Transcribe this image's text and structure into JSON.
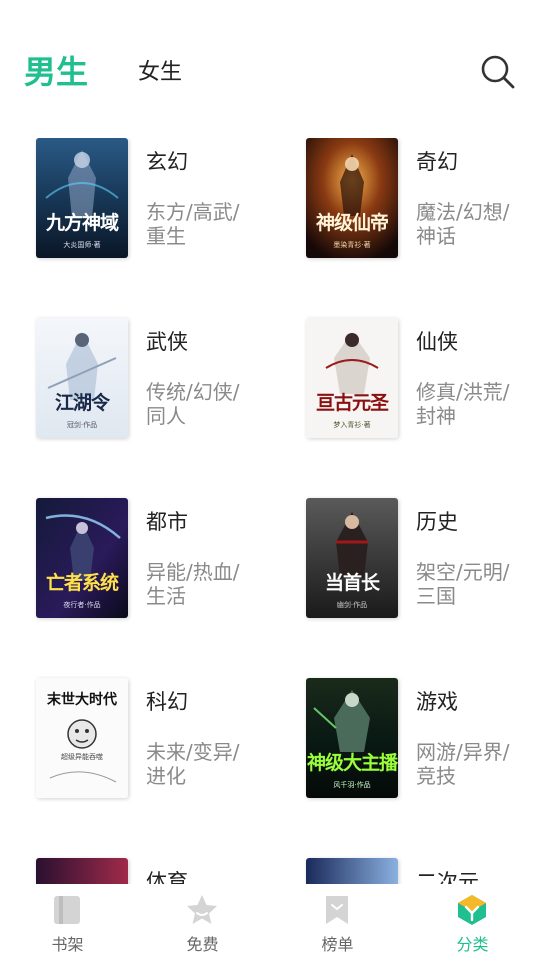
{
  "header": {
    "tab_male": "男生",
    "tab_female": "女生",
    "search_icon": "search-icon"
  },
  "categories": [
    {
      "name": "玄幻",
      "tags": "东方/高武/重生",
      "cover_title": "九方神域",
      "cover_sub": "大炎国师·著"
    },
    {
      "name": "奇幻",
      "tags": "魔法/幻想/神话",
      "cover_title": "神级仙帝",
      "cover_sub": "墨染青衫·著"
    },
    {
      "name": "武侠",
      "tags": "传统/幻侠/同人",
      "cover_title": "江湖令",
      "cover_sub": "冠剑·作品"
    },
    {
      "name": "仙侠",
      "tags": "修真/洪荒/封神",
      "cover_title": "亘古元圣",
      "cover_sub": "梦入青衫·著"
    },
    {
      "name": "都市",
      "tags": "异能/热血/生活",
      "cover_title": "亡者系统",
      "cover_sub": "夜行者·作品"
    },
    {
      "name": "历史",
      "tags": "架空/元明/三国",
      "cover_title": "当首长",
      "cover_sub": "幽剑·作品"
    },
    {
      "name": "科幻",
      "tags": "未来/变异/进化",
      "cover_title": "末世大时代",
      "cover_sub": "超级异能吞噬"
    },
    {
      "name": "游戏",
      "tags": "网游/异界/竞技",
      "cover_title": "神级大主播",
      "cover_sub": "风千羽·作品"
    },
    {
      "name": "体育",
      "tags": "",
      "cover_title": "",
      "cover_sub": ""
    },
    {
      "name": "二次元",
      "tags": "",
      "cover_title": "",
      "cover_sub": ""
    }
  ],
  "tabbar": [
    {
      "label": "书架",
      "icon": "bookshelf-icon",
      "active": false
    },
    {
      "label": "免费",
      "icon": "star-icon",
      "active": false
    },
    {
      "label": "榜单",
      "icon": "ranking-bookmark-icon",
      "active": false
    },
    {
      "label": "分类",
      "icon": "category-icon",
      "active": true
    }
  ],
  "colors": {
    "accent": "#1fbf8f",
    "text_primary": "#222222",
    "text_secondary": "#8a8a8a",
    "tab_inactive": "#666666",
    "icon_inactive": "#cccccc"
  }
}
